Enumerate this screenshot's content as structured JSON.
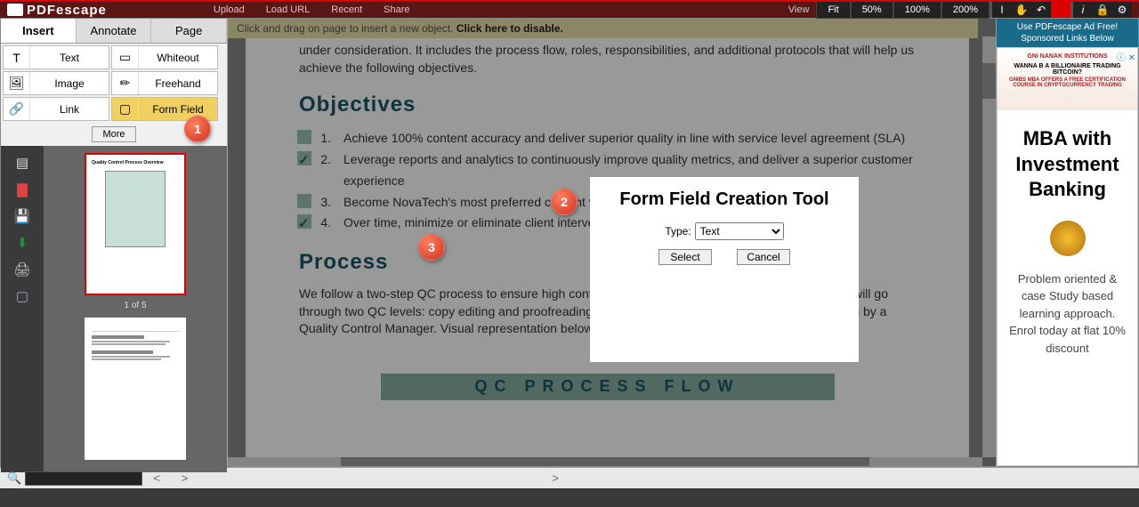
{
  "top_menu": {
    "upload": "Upload",
    "load_url": "Load URL",
    "recent": "Recent",
    "share": "Share"
  },
  "view": {
    "label": "View",
    "fit": "Fit",
    "z50": "50%",
    "z100": "100%",
    "z200": "200%"
  },
  "tabs": {
    "insert": "Insert",
    "annotate": "Annotate",
    "page": "Page"
  },
  "tools": {
    "text": "Text",
    "whiteout": "Whiteout",
    "image": "Image",
    "freehand": "Freehand",
    "link": "Link",
    "formfield": "Form Field",
    "more": "More"
  },
  "hint": {
    "prefix": "Click and drag on page to insert a new object. ",
    "link": "Click here to disable."
  },
  "thumb_caption": "1 of 5",
  "doc": {
    "intro": "under consideration. It includes the process flow, roles, responsibilities, and additional protocols that will help us achieve the following objectives.",
    "h_objectives": "Objectives",
    "obj1": "Achieve 100% content accuracy and deliver superior quality in line with service level agreement (SLA)",
    "obj2": "Leverage reports and analytics to continuously improve quality metrics, and deliver a superior customer experience",
    "obj3": "Become NovaTech's most preferred content vendor",
    "obj4": "Over time, minimize or eliminate client intervention in regards to quality",
    "h_process": "Process",
    "process_p": "We follow a two-step QC process to ensure high content accuracy & consistency. Each writer's work will go through two QC levels: copy editing and proofreading. The entire process will be owned and overseen by a Quality Control Manager. Visual representation below.",
    "flow_title": "QC PROCESS FLOW"
  },
  "modal": {
    "title": "Form Field Creation Tool",
    "type_label": "Type:",
    "type_value": "Text",
    "select": "Select",
    "cancel": "Cancel"
  },
  "ads": {
    "header1": "Use PDFescape Ad Free!",
    "header2": "Sponsored Links Below",
    "top_text1": "WANNA B A BILLIONAIRE TRADING BITCOIN?",
    "top_text2": "GNIBS MBA OFFERS A FREE CERTIFICATION COURSE IN CRYPTOCURRENCY TRADING",
    "big": "MBA with Investment Banking",
    "body": "Problem oriented & case Study based learning approach. Enrol today at flat 10% discount"
  },
  "nav": {
    "prev": "<",
    "next": ">"
  },
  "markers": {
    "m1": "1",
    "m2": "2",
    "m3": "3"
  }
}
